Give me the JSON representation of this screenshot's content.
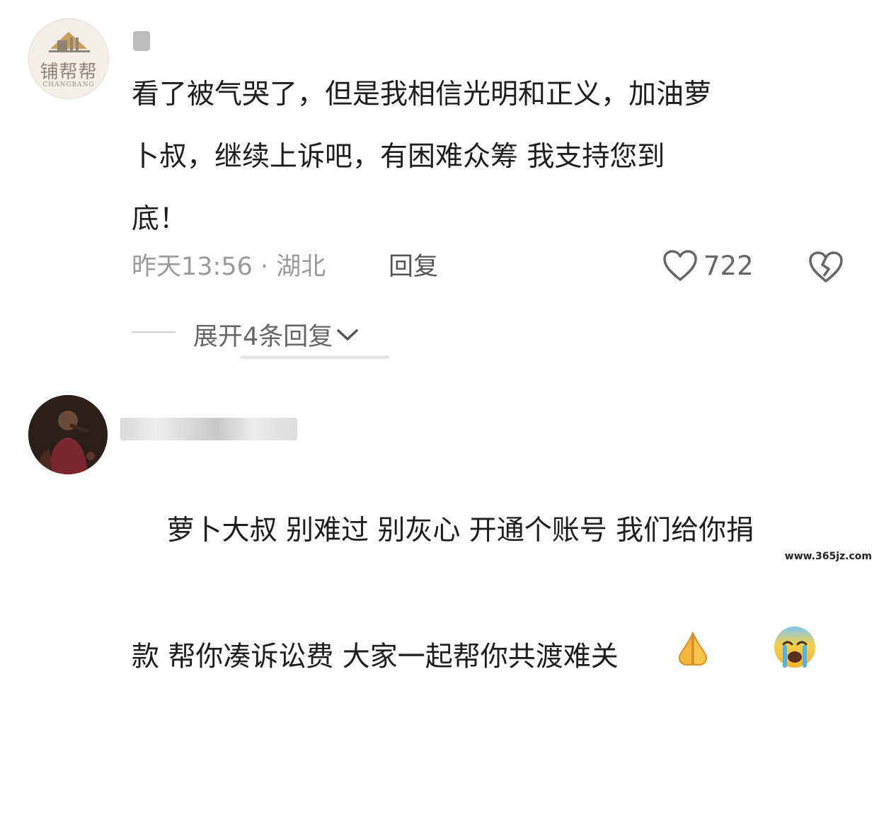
{
  "comment1": {
    "avatar_text": "铺帮帮",
    "avatar_subtext": "CHANGBANG",
    "text": "看了被气哭了，但是我相信光明和正义，加油萝\n卜叔，继续上诉吧，有困难众筹 我支持您到\n底！",
    "time_location": "昨天13:56 · 湖北",
    "reply_label": "回复",
    "like_count": "722",
    "expand_label": "展开4条回复"
  },
  "comment2": {
    "text": "萝卜大叔 别难过 别灰心 开通个账号 我们给你捐\n款 帮你凑诉讼费 大家一起帮你共渡难关",
    "emoji_1": "folded-hands",
    "emoji_2": "crying-face"
  },
  "watermark": "www.365jz.com"
}
